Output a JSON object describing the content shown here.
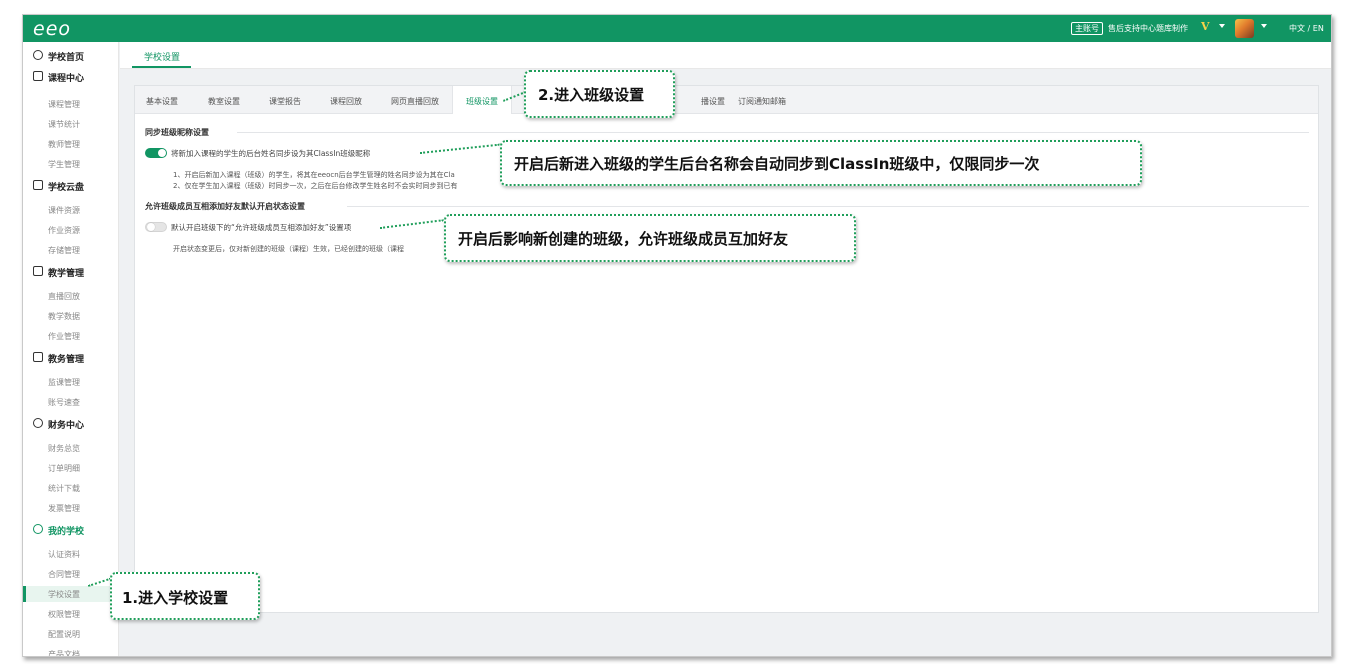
{
  "topbar": {
    "logo": "eeo",
    "account_badge": "主账号",
    "account_name": "售后支持中心题库制作",
    "vip_mark": "V",
    "language": "中文 / EN"
  },
  "sidebar": {
    "items": [
      {
        "type": "section",
        "label": "学校首页",
        "icon": "clock-icon"
      },
      {
        "type": "section",
        "label": "课程中心",
        "icon": "calendar-icon"
      },
      {
        "type": "sub",
        "label": "课程管理"
      },
      {
        "type": "sub",
        "label": "课节统计"
      },
      {
        "type": "sub",
        "label": "教师管理"
      },
      {
        "type": "sub",
        "label": "学生管理"
      },
      {
        "type": "section",
        "label": "学校云盘",
        "icon": "cloud-icon"
      },
      {
        "type": "sub",
        "label": "课件资源"
      },
      {
        "type": "sub",
        "label": "作业资源"
      },
      {
        "type": "sub",
        "label": "存储管理"
      },
      {
        "type": "section",
        "label": "教学管理",
        "icon": "monitor-icon"
      },
      {
        "type": "sub",
        "label": "直播回放"
      },
      {
        "type": "sub",
        "label": "教学数据"
      },
      {
        "type": "sub",
        "label": "作业管理"
      },
      {
        "type": "section",
        "label": "教务管理",
        "icon": "grid-icon"
      },
      {
        "type": "sub",
        "label": "监课管理"
      },
      {
        "type": "sub",
        "label": "账号速查"
      },
      {
        "type": "section",
        "label": "财务中心",
        "icon": "yen-icon"
      },
      {
        "type": "sub",
        "label": "财务总览"
      },
      {
        "type": "sub",
        "label": "订单明细"
      },
      {
        "type": "sub",
        "label": "统计下载"
      },
      {
        "type": "sub",
        "label": "发票管理"
      },
      {
        "type": "section",
        "label": "我的学校",
        "icon": "school-icon",
        "active": true
      },
      {
        "type": "sub",
        "label": "认证资料"
      },
      {
        "type": "sub",
        "label": "合同管理"
      },
      {
        "type": "sub",
        "label": "学校设置",
        "active": true
      },
      {
        "type": "sub",
        "label": "权限管理"
      },
      {
        "type": "sub",
        "label": "配置说明"
      },
      {
        "type": "sub",
        "label": "产品文档"
      }
    ]
  },
  "main": {
    "page_tab": "学校设置",
    "tabs": [
      {
        "label": "基本设置"
      },
      {
        "label": "教室设置"
      },
      {
        "label": "课堂报告"
      },
      {
        "label": "课程回放"
      },
      {
        "label": "网页直播回放"
      },
      {
        "label": "班级设置",
        "active": true
      },
      {
        "label": "播设置"
      },
      {
        "label": "订阅通知邮箱"
      }
    ],
    "section1": {
      "title": "同步班级昵称设置",
      "toggle_label": "将新加入课程的学生的后台姓名同步设为其ClassIn班级昵称",
      "toggle_on": true,
      "note1": "1、开启后新加入课程（班级）的学生，将其在eeocn后台学生管理的姓名同步设为其在Cla",
      "note2": "2、仅在学生加入课程（班级）时同步一次，之后在后台修改学生姓名时不会实时同步到已有"
    },
    "section2": {
      "title": "允许班级成员互相添加好友默认开启状态设置",
      "toggle_label": "默认开启班级下的“允许班级成员互相添加好友”设置项",
      "toggle_on": false,
      "note": "开启状态变更后，仅对新创建的班级（课程）生效，已经创建的班级（课程"
    }
  },
  "callouts": {
    "step1": "1.进入学校设置",
    "step2": "2.进入班级设置",
    "sync_note": "开启后新进入班级的学生后台名称会自动同步到ClassIn班级中，仅限同步一次",
    "friend_note": "开启后影响新创建的班级，允许班级成员互加好友"
  },
  "colors": {
    "brand_green": "#119563",
    "callout_border": "#1f9e5a"
  }
}
